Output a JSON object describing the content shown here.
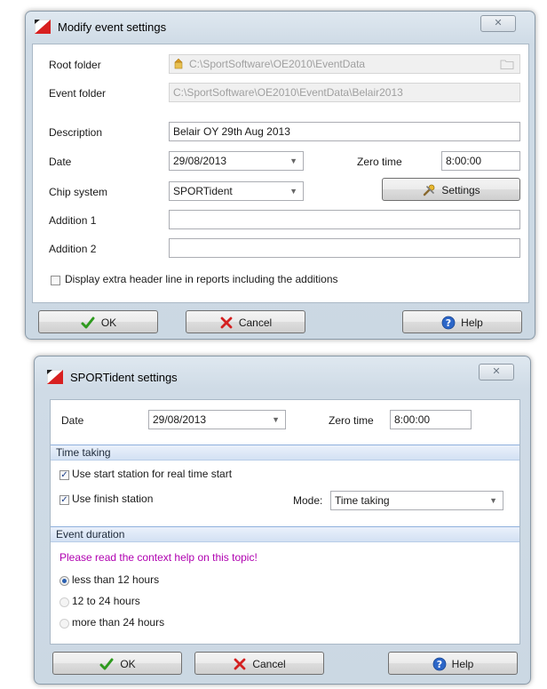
{
  "modify_dialog": {
    "title": "Modify event settings",
    "close_glyph": "✕",
    "root_folder": {
      "label": "Root folder",
      "value": "C:\\SportSoftware\\OE2010\\EventData"
    },
    "event_folder": {
      "label": "Event folder",
      "value": "C:\\SportSoftware\\OE2010\\EventData\\Belair2013"
    },
    "description": {
      "label": "Description",
      "value": "Belair OY 29th Aug 2013"
    },
    "date": {
      "label": "Date",
      "value": "29/08/2013"
    },
    "zero_time": {
      "label": "Zero time",
      "value": "8:00:00"
    },
    "chip_system": {
      "label": "Chip system",
      "value": "SPORTident"
    },
    "settings_button": "Settings",
    "addition1": {
      "label": "Addition 1",
      "value": ""
    },
    "addition2": {
      "label": "Addition 2",
      "value": ""
    },
    "extra_header": {
      "label": "Display extra header line in reports including the additions",
      "checked": false
    },
    "ok_button": "OK",
    "cancel_button": "Cancel",
    "help_button": "Help"
  },
  "sportident_dialog": {
    "title": "SPORTident settings",
    "close_glyph": "✕",
    "date": {
      "label": "Date",
      "value": "29/08/2013"
    },
    "zero_time": {
      "label": "Zero time",
      "value": "8:00:00"
    },
    "time_taking": {
      "header": "Time taking",
      "use_start_station": {
        "label": "Use start station for real time start",
        "checked": true
      },
      "use_finish_station": {
        "label": "Use finish station",
        "checked": true
      },
      "mode": {
        "label": "Mode:",
        "value": "Time taking"
      }
    },
    "event_duration": {
      "header": "Event duration",
      "note": "Please read the context help on this topic!",
      "options": [
        {
          "label": "less than 12 hours",
          "selected": true
        },
        {
          "label": "12 to 24 hours",
          "selected": false
        },
        {
          "label": "more than 24 hours",
          "selected": false
        }
      ]
    },
    "ok_button": "OK",
    "cancel_button": "Cancel",
    "help_button": "Help"
  },
  "icons": {
    "app": "app-logo-icon",
    "folder": "folder-icon",
    "folder_browse": "folder-browse-icon",
    "settings": "settings-tools-icon",
    "ok": "checkmark-icon",
    "cancel": "cross-icon",
    "help": "help-icon",
    "dropdown": "chevron-down-icon"
  },
  "colors": {
    "ok_green": "#2e9a1e",
    "cancel_red": "#d42020",
    "help_blue": "#2c66c8",
    "note_magenta": "#b000b0",
    "logo_red": "#d82020"
  }
}
